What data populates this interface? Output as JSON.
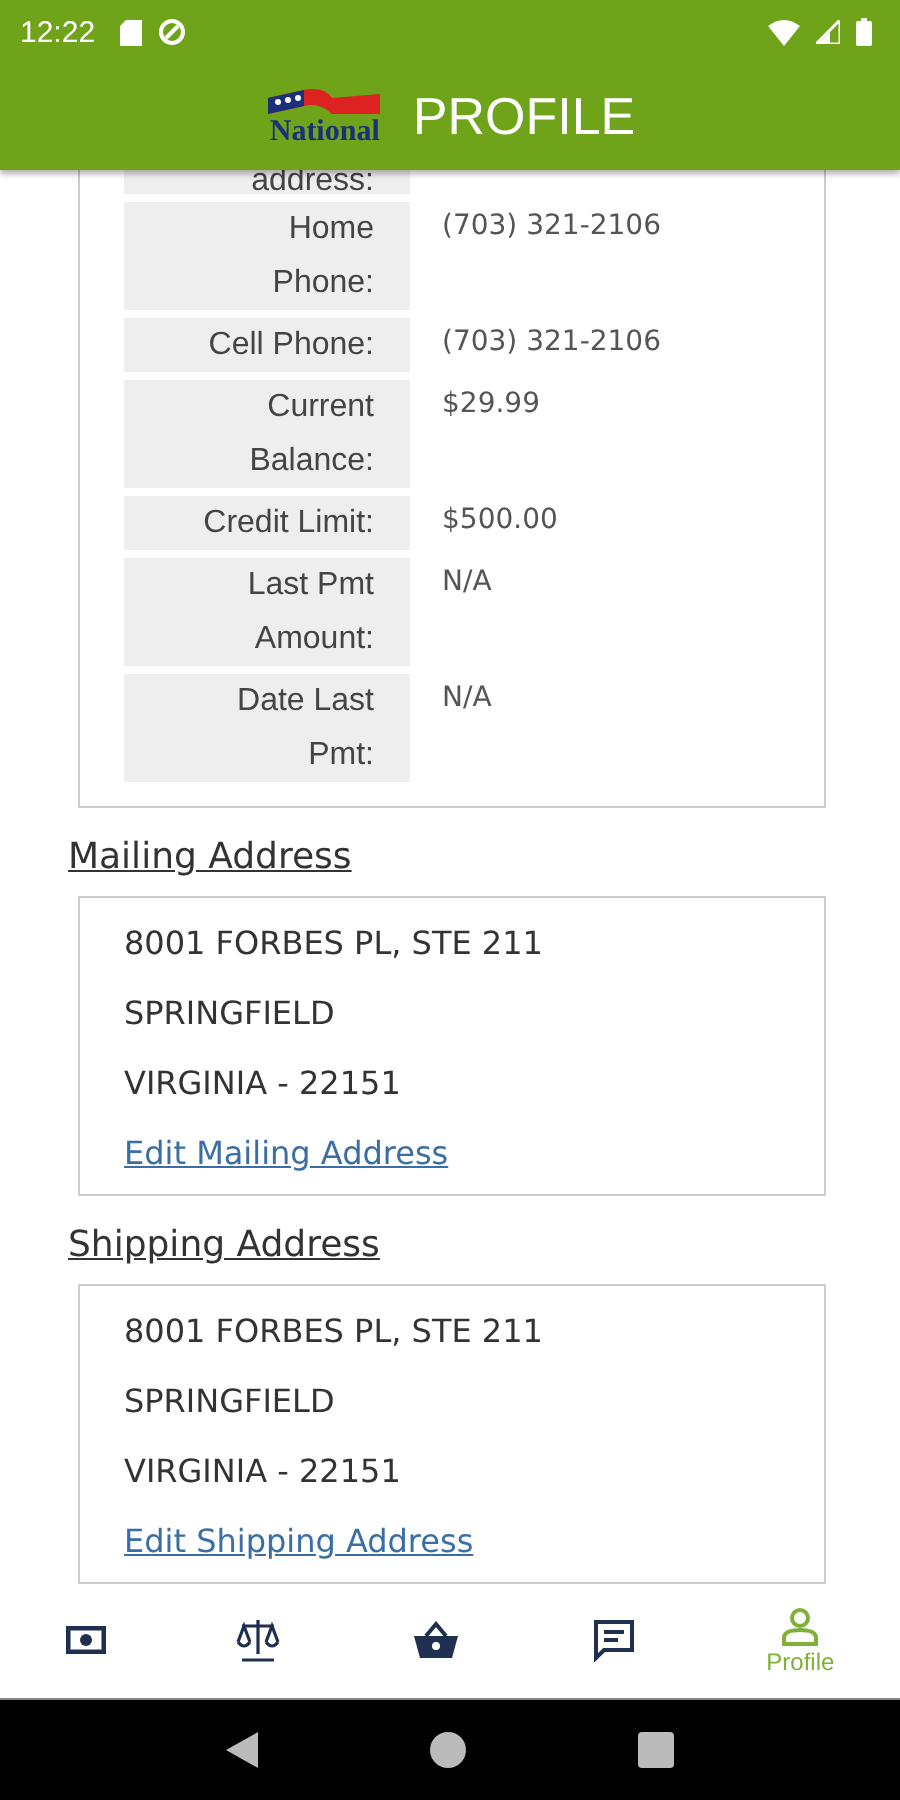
{
  "status_bar": {
    "time": "12:22"
  },
  "header": {
    "logo_text": "National",
    "title": "PROFILE"
  },
  "account_details": [
    {
      "label": "address:"
    },
    {
      "label": "Home Phone:",
      "value": "(703) 321-2106"
    },
    {
      "label": "Cell Phone:",
      "value": "(703) 321-2106"
    },
    {
      "label": "Current Balance:",
      "value": "$29.99"
    },
    {
      "label": "Credit Limit:",
      "value": "$500.00"
    },
    {
      "label": "Last Pmt Amount:",
      "value": "N/A"
    },
    {
      "label": "Date Last Pmt:",
      "value": "N/A"
    }
  ],
  "addresses": [
    {
      "heading": "Mailing Address",
      "lines": [
        "8001 FORBES PL, STE 211",
        "SPRINGFIELD",
        "VIRGINIA - 22151"
      ],
      "link": "Edit Mailing Address"
    },
    {
      "heading": "Shipping Address",
      "lines": [
        "8001 FORBES PL, STE 211",
        "SPRINGFIELD",
        "VIRGINIA - 22151"
      ],
      "link": "Edit Shipping Address"
    }
  ],
  "bottom_nav": [
    {
      "kind": "cash",
      "selected": false
    },
    {
      "kind": "scale",
      "selected": false
    },
    {
      "kind": "basket",
      "selected": false
    },
    {
      "kind": "message",
      "selected": false
    },
    {
      "kind": "profile",
      "selected": true,
      "label": "Profile"
    }
  ]
}
